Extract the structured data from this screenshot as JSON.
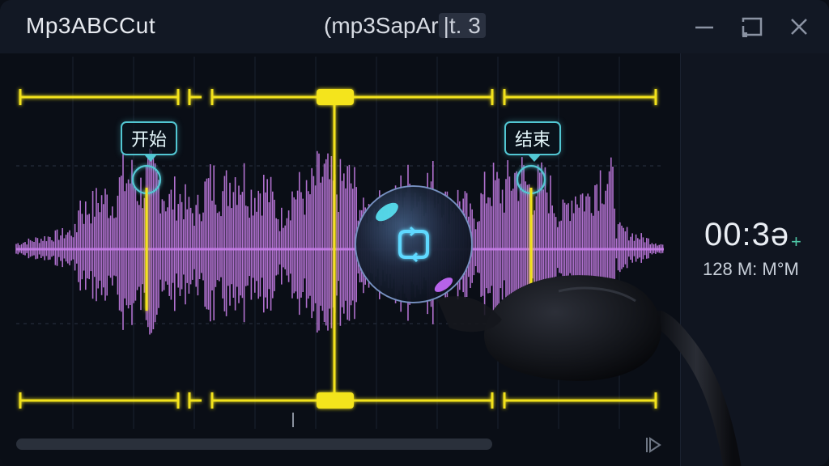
{
  "window": {
    "app_title": "Mp3ABCCut",
    "file_title_main": "(mp3SapAr",
    "file_title_sel": "|t. 3"
  },
  "markers": {
    "start_label": "开始",
    "end_label": "结束"
  },
  "info": {
    "time": "00:3ə",
    "time_suffix": "+",
    "meta": "128 M: M°M"
  },
  "icons": [
    "minimize-icon",
    "maximize-icon",
    "close-icon",
    "loop-icon",
    "play-icon"
  ],
  "colors": {
    "accent_yellow": "#f2e21c",
    "waveform": "#c77ee8",
    "marker_cyan": "#52c7d3",
    "time_plus": "#4ec7a6"
  }
}
